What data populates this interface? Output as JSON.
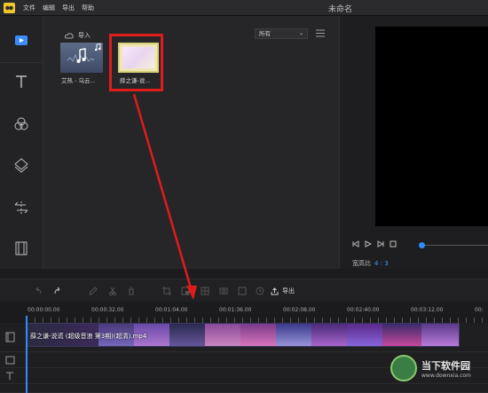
{
  "app": {
    "title": "未命名",
    "menu": [
      "文件",
      "编辑",
      "导出",
      "帮助"
    ]
  },
  "sidebar": {
    "items": [
      {
        "name": "media",
        "icon": "media-icon",
        "active": true
      },
      {
        "name": "text",
        "icon": "text-icon"
      },
      {
        "name": "filter",
        "icon": "filter-icon"
      },
      {
        "name": "overlay",
        "icon": "overlay-icon"
      },
      {
        "name": "transition",
        "icon": "transition-icon"
      },
      {
        "name": "element",
        "icon": "film-icon"
      }
    ]
  },
  "media": {
    "import_label": "导入",
    "filter_value": "所有",
    "items": [
      {
        "caption": "艾热 - 乌云...",
        "type": "audio"
      },
      {
        "caption": "薛之谦-说...",
        "type": "video",
        "selected": true
      }
    ]
  },
  "preview": {
    "ratio_label": "宽高比",
    "ratio_value": "4 : 3"
  },
  "toolbar": {
    "export_label": "导出"
  },
  "timeline": {
    "ruler_labels": [
      "00:00:00.00",
      "00:00:32.00",
      "00:01:04.00",
      "00:01:36.00",
      "00:02:08.00",
      "00:02:40.00",
      "00:03:12.00",
      "00:"
    ],
    "clip_label": "薛之谦-说谎 (超级音浪 第3期)(超清).mp4"
  },
  "watermark": {
    "text": "当下软件园",
    "url": "www.downxia.com"
  },
  "colors": {
    "accent": "#2f8cff",
    "highlight": "#e01b1b",
    "logo": "#f2c52a"
  }
}
